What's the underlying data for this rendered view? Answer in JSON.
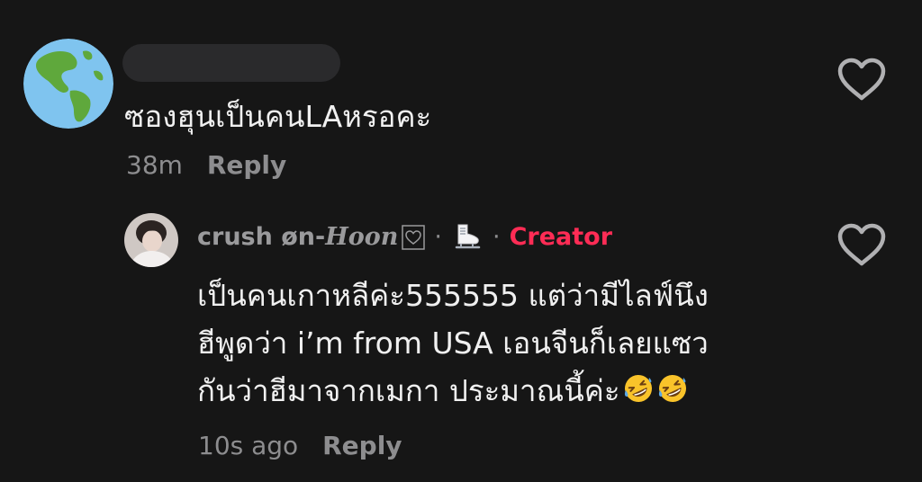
{
  "comment": {
    "text": "ซองฮุนเป็นคนLAหรอคะ",
    "time": "38m",
    "reply_label": "Reply",
    "avatar_icon": "globe-americas-icon",
    "like_icon": "heart-outline-icon"
  },
  "reply": {
    "author": "crush øn-",
    "author_styled": "Hoon",
    "separator": "·",
    "badge_icon": "ice-skate-icon",
    "creator_label": "Creator",
    "lines": [
      "เป็นคนเกาหลีค่ะ555555 แต่ว่ามีไลฟ์นึง",
      "ฮีพูดว่า i’m from USA เอนจีนก็เลยแซว",
      "กันว่าฮีมาจากเมกา ประมาณนี้ค่ะ"
    ],
    "emoji_icon": "rolling-on-floor-laughing-emoji",
    "time": "10s ago",
    "reply_label": "Reply",
    "like_icon": "heart-outline-icon"
  },
  "colors": {
    "background": "#161616",
    "creator": "#fe2c55",
    "muted": "#8d8d8f"
  }
}
